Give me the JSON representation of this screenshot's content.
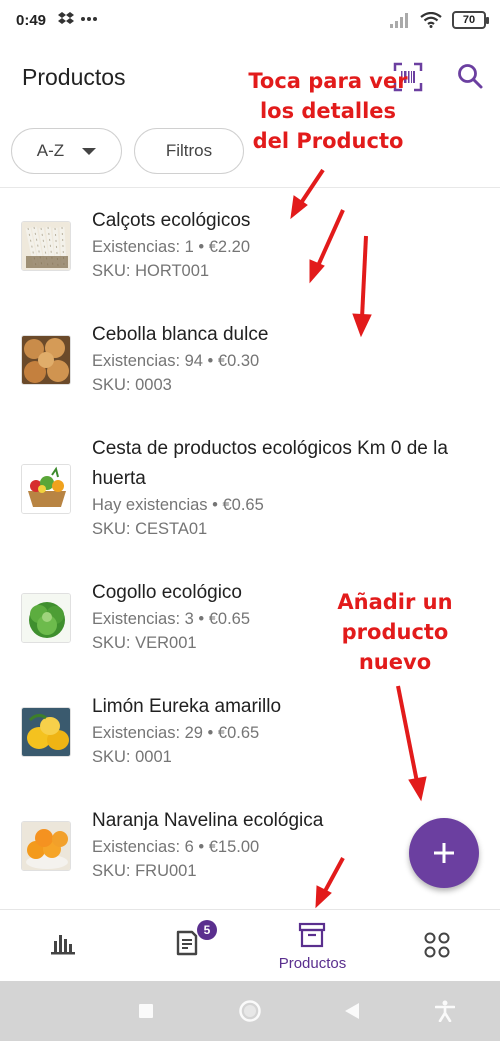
{
  "status_bar": {
    "time": "0:49",
    "battery": "70",
    "icons": [
      "dropbox-icon",
      "more-icon",
      "signal-icon",
      "wifi-icon",
      "battery-icon"
    ]
  },
  "app_bar": {
    "title": "Productos",
    "icons": [
      "barcode-scan-icon",
      "search-icon"
    ]
  },
  "filters": {
    "sort_label": "A-Z",
    "filter_label": "Filtros"
  },
  "products": [
    {
      "name": "Calçots ecológicos",
      "stock": "Existencias: 1 • €2.20",
      "sku": "SKU: HORT001",
      "image": "calcots-image"
    },
    {
      "name": "Cebolla blanca dulce",
      "stock": "Existencias: 94 • €0.30",
      "sku": "SKU: 0003",
      "image": "onions-image"
    },
    {
      "name": "Cesta de productos ecológicos Km 0 de la huerta",
      "stock": "Hay existencias • €0.65",
      "sku": "SKU: CESTA01",
      "image": "basket-image"
    },
    {
      "name": "Cogollo ecológico",
      "stock": "Existencias: 3 • €0.65",
      "sku": "SKU: VER001",
      "image": "lettuce-image"
    },
    {
      "name": "Limón Eureka amarillo",
      "stock": "Existencias: 29 • €0.65",
      "sku": "SKU: 0001",
      "image": "lemons-image"
    },
    {
      "name": "Naranja Navelina ecológica",
      "stock": "Existencias: 6 • €15.00",
      "sku": "SKU: FRU001",
      "image": "oranges-image"
    }
  ],
  "annotations": {
    "details": [
      "Toca para ver",
      "los detalles",
      "del Producto"
    ],
    "add_new": [
      "Añadir un",
      "producto",
      "nuevo"
    ],
    "color": "#e21b1b"
  },
  "bottom_nav": {
    "items": [
      {
        "name": "dashboard",
        "icon": "bar-chart-icon",
        "label": ""
      },
      {
        "name": "orders",
        "icon": "receipt-icon",
        "label": "",
        "badge": "5"
      },
      {
        "name": "products",
        "icon": "archive-box-icon",
        "label": "Productos",
        "active": true
      },
      {
        "name": "more",
        "icon": "grid-icon",
        "label": ""
      }
    ]
  },
  "colors": {
    "accent": "#6b3fa0",
    "nav_active": "#5a2f8e",
    "secondary_text": "#757575"
  }
}
